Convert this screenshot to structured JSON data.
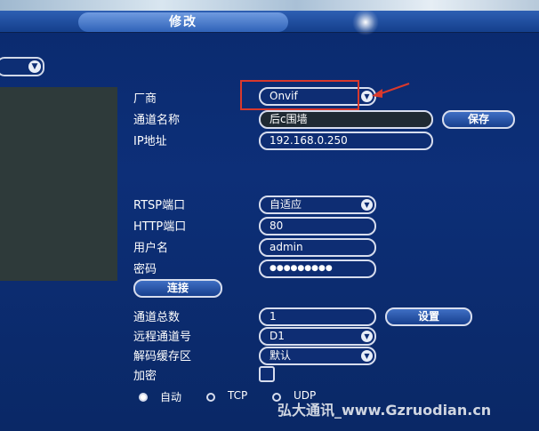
{
  "dialog": {
    "title": "修改",
    "top_selector": ""
  },
  "form": {
    "vendor_label": "厂商",
    "vendor_value": "Onvif",
    "channel_name_label": "通道名称",
    "channel_name_value": "后c围墙",
    "save_label": "保存",
    "ip_label": "IP地址",
    "ip_value": "192.168.0.250",
    "rtsp_label": "RTSP端口",
    "rtsp_value": "自适应",
    "http_label": "HTTP端口",
    "http_value": "80",
    "username_label": "用户名",
    "username_value": "admin",
    "password_label": "密码",
    "password_value": "●●●●●●●●●",
    "connect_label": "连接",
    "channel_total_label": "通道总数",
    "channel_total_value": "1",
    "setup_label": "设置",
    "remote_channel_label": "远程通道号",
    "remote_channel_value": "D1",
    "decode_buffer_label": "解码缓存区",
    "decode_buffer_value": "默认",
    "encrypt_label": "加密"
  },
  "protocol": {
    "options": [
      "自动",
      "TCP",
      "UDP"
    ],
    "selected": "自动"
  },
  "watermark": "弘大通讯_www.Gzruodian.cn",
  "colors": {
    "background": "#0d2f78",
    "highlight": "#d9392c",
    "text": "#ffffff"
  },
  "icons": {
    "dropdown": "chevron-down-icon",
    "arrow": "red-arrow-annotation"
  }
}
